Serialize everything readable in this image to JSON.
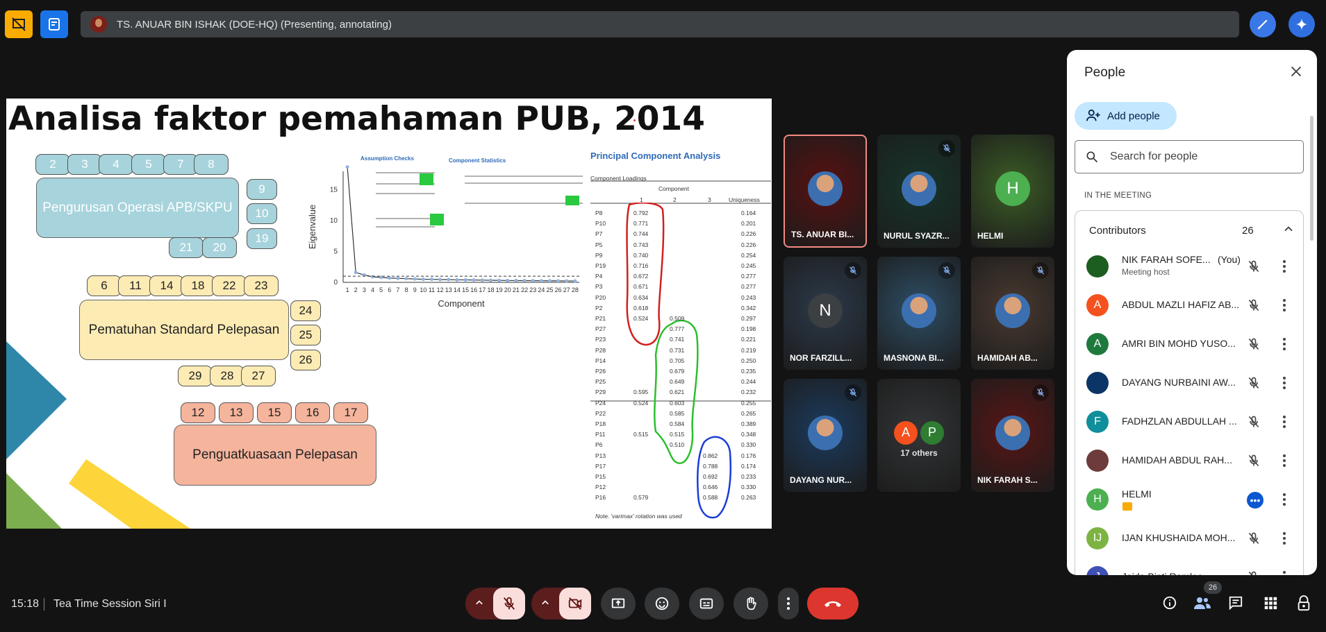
{
  "presenter_bar": {
    "label": "TS. ANUAR BIN ISHAK (DOE-HQ) (Presenting, annotating)"
  },
  "slide": {
    "title": "Analisa faktor pemahaman PUB, 2014",
    "group1": {
      "label": "Pengurusan Operasi APB/SKPU",
      "items": [
        "2",
        "3",
        "4",
        "5",
        "7",
        "8",
        "9",
        "10",
        "19",
        "21",
        "20"
      ]
    },
    "group2": {
      "label": "Pematuhan Standard Pelepasan",
      "items": [
        "6",
        "11",
        "14",
        "18",
        "22",
        "23",
        "24",
        "25",
        "26",
        "29",
        "28",
        "27"
      ]
    },
    "group3": {
      "label": "Penguatkuasaan Pelepasan",
      "items": [
        "12",
        "13",
        "15",
        "16",
        "17"
      ]
    },
    "scree": {
      "ylabel": "Eigenvalue",
      "xlabel": "Component",
      "yticks": [
        "15",
        "10",
        "5",
        "0"
      ],
      "xticks": [
        "1",
        "2",
        "3",
        "4",
        "5",
        "6",
        "7",
        "8",
        "9",
        "10",
        "11",
        "12",
        "13",
        "14",
        "15",
        "16",
        "17",
        "18",
        "19",
        "20",
        "21",
        "22",
        "23",
        "24",
        "25",
        "26",
        "27",
        "28"
      ]
    },
    "assumption_title": "Assumption Checks",
    "component_stats_title": "Component Statistics",
    "pca": {
      "title": "Principal Component Analysis",
      "loadings_label": "Component Loadings",
      "component_header": "Component",
      "col1": "1",
      "col2": "2",
      "col3": "3",
      "uniqueness_header": "Uniqueness",
      "rows": [
        [
          "P8",
          "0.792",
          "",
          "",
          "0.164"
        ],
        [
          "P10",
          "0.771",
          "",
          "",
          "0.201"
        ],
        [
          "P7",
          "0.744",
          "",
          "",
          "0.226"
        ],
        [
          "P5",
          "0.743",
          "",
          "",
          "0.226"
        ],
        [
          "P9",
          "0.740",
          "",
          "",
          "0.254"
        ],
        [
          "P19",
          "0.716",
          "",
          "",
          "0.245"
        ],
        [
          "P4",
          "0.672",
          "",
          "",
          "0.277"
        ],
        [
          "P3",
          "0.671",
          "",
          "",
          "0.277"
        ],
        [
          "P20",
          "0.634",
          "",
          "",
          "0.243"
        ],
        [
          "P2",
          "0.618",
          "",
          "",
          "0.342"
        ],
        [
          "P21",
          "0.524",
          "0.509",
          "",
          "0.297"
        ],
        [
          "P27",
          "",
          "0.777",
          "",
          "0.198"
        ],
        [
          "P23",
          "",
          "0.741",
          "",
          "0.221"
        ],
        [
          "P28",
          "",
          "0.731",
          "",
          "0.219"
        ],
        [
          "P14",
          "",
          "0.705",
          "",
          "0.250"
        ],
        [
          "P26",
          "",
          "0.679",
          "",
          "0.235"
        ],
        [
          "P25",
          "",
          "0.649",
          "",
          "0.244"
        ],
        [
          "P29",
          "0.595",
          "0.621",
          "",
          "0.232"
        ],
        [
          "P24",
          "0.524",
          "0.603",
          "",
          "0.255"
        ],
        [
          "P22",
          "",
          "0.585",
          "",
          "0.265"
        ],
        [
          "P18",
          "",
          "0.584",
          "",
          "0.389"
        ],
        [
          "P11",
          "0.515",
          "0.515",
          "",
          "0.348"
        ],
        [
          "P6",
          "",
          "0.510",
          "",
          "0.330"
        ],
        [
          "P13",
          "",
          "",
          "0.862",
          "0.176"
        ],
        [
          "P17",
          "",
          "",
          "0.788",
          "0.174"
        ],
        [
          "P15",
          "",
          "",
          "0.692",
          "0.233"
        ],
        [
          "P12",
          "",
          "",
          "0.646",
          "0.330"
        ],
        [
          "P16",
          "0.579",
          "",
          "0.588",
          "0.263"
        ]
      ],
      "note": "Note. 'varimax' rotation was used"
    }
  },
  "tiles": [
    {
      "name": "TS. ANUAR BI...",
      "muted": false
    },
    {
      "name": "NURUL SYAZR...",
      "muted": true
    },
    {
      "name": "HELMI",
      "initial": "H",
      "muted": false
    },
    {
      "name": "NOR FARZILL...",
      "initial": "N",
      "muted": true
    },
    {
      "name": "MASNONA BI...",
      "muted": true
    },
    {
      "name": "HAMIDAH AB...",
      "muted": true
    },
    {
      "name": "DAYANG NUR...",
      "muted": true
    },
    {
      "name": "17 others",
      "initials": [
        "A",
        "P"
      ]
    },
    {
      "name": "NIK FARAH S...",
      "muted": true
    }
  ],
  "people_panel": {
    "title": "People",
    "add_people": "Add people",
    "search_placeholder": "Search for people",
    "in_meeting": "IN THE MEETING",
    "contributors_label": "Contributors",
    "contributors_count": "26",
    "people": [
      {
        "name": "NIK FARAH SOFE...",
        "you": "(You)",
        "sub": "Meeting host",
        "color": "#1b5e20"
      },
      {
        "name": "ABDUL MAZLI HAFIZ AB...",
        "initial": "A",
        "color": "#f4511e"
      },
      {
        "name": "AMRI BIN MOHD YUSO...",
        "initial": "A",
        "color": "#1e7a3c"
      },
      {
        "name": "DAYANG NURBAINI AW...",
        "color": "#0b3566"
      },
      {
        "name": "FADHZLAN ABDULLAH ...",
        "initial": "F",
        "color": "#0f8f9b"
      },
      {
        "name": "HAMIDAH ABDUL RAH...",
        "color": "#6d3b3b"
      },
      {
        "name": "HELMI",
        "initial": "H",
        "color": "#4caf50"
      },
      {
        "name": "IJAN KHUSHAIDA MOH...",
        "initial": "IJ",
        "color": "#7cb342"
      },
      {
        "name": "Jaida Binti Ramlee",
        "initial": "J",
        "color": "#3f51b5"
      }
    ]
  },
  "bottom": {
    "time": "15:18",
    "meeting_title": "Tea Time Session Siri I",
    "people_badge": "26"
  }
}
